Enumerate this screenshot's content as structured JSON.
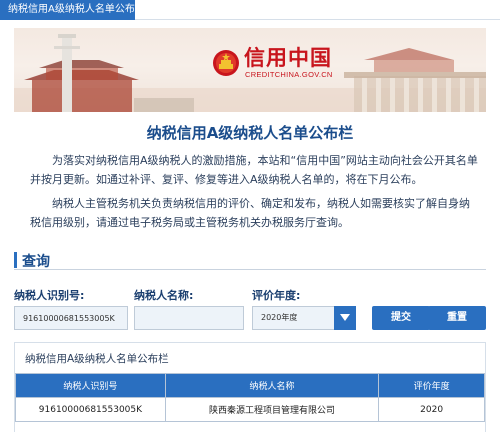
{
  "tab": {
    "label": "纳税信用A级纳税人名单公布栏"
  },
  "banner": {
    "brand": "信用中国",
    "url": "CREDITCHINA.GOV.CN"
  },
  "page": {
    "title": "纳税信用A级纳税人名单公布栏"
  },
  "intro": [
    "为落实对纳税信用A级纳税人的激励措施，本站和“信用中国”网站主动向社会公开其名单并按月更新。如通过补评、复评、修复等进入A级纳税人名单的，将在下月公布。",
    "纳税人主管税务机关负责纳税信用的评价、确定和发布，纳税人如需要核实了解自身纳税信用级别，请通过电子税务局或主管税务机关办税服务厅查询。"
  ],
  "query": {
    "section_title": "查询",
    "taxpayer_id_label": "纳税人识别号:",
    "taxpayer_id_value": "916100006815530​05K",
    "taxpayer_name_label": "纳税人名称:",
    "taxpayer_name_value": "",
    "year_label": "评价年度:",
    "year_value": "2020年度",
    "submit_label": "提交",
    "reset_label": "重置"
  },
  "results": {
    "title": "纳税信用A级纳税人名单公布栏",
    "columns": [
      "纳税人识别号",
      "纳税人名称",
      "评价年度"
    ],
    "rows": [
      [
        "916100006815530​05K",
        "陕西秦源工程项目管理有限公司",
        "2020"
      ]
    ]
  },
  "colors": {
    "accent": "#2a6fc0",
    "brand_red": "#c8151d",
    "title_blue": "#1b4d8c"
  },
  "icons": {
    "emblem": "national-emblem-icon",
    "dropdown": "chevron-down-icon"
  }
}
